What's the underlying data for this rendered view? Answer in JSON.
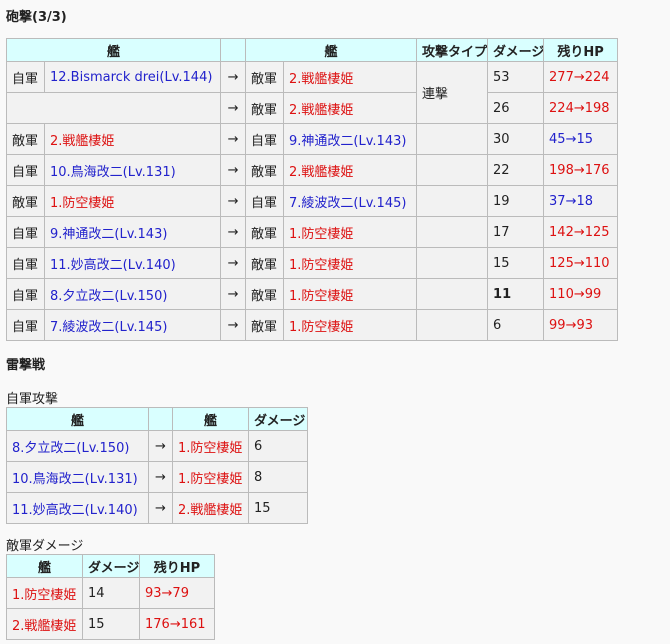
{
  "shelling": {
    "title": "砲撃(3/3)",
    "headers": [
      "艦",
      "艦",
      "攻撃タイプ",
      "ダメージ",
      "残りHP"
    ],
    "attack_type": "連撃",
    "rows": [
      {
        "side_a": "自軍",
        "ship_a": "12.Bismarck drei(Lv.144)",
        "ship_a_color": "blue",
        "arrow": "→",
        "side_b": "敵軍",
        "ship_b": "2.戦艦棲姫",
        "ship_b_color": "red",
        "damage": "53",
        "hp": "277→224",
        "hp_color": "red"
      },
      {
        "side_a": "",
        "ship_a": "",
        "ship_a_color": "blue",
        "arrow": "→",
        "side_b": "敵軍",
        "ship_b": "2.戦艦棲姫",
        "ship_b_color": "red",
        "damage": "26",
        "hp": "224→198",
        "hp_color": "red"
      },
      {
        "side_a": "敵軍",
        "ship_a": "2.戦艦棲姫",
        "ship_a_color": "red",
        "arrow": "→",
        "side_b": "自軍",
        "ship_b": "9.神通改二(Lv.143)",
        "ship_b_color": "blue",
        "damage": "30",
        "hp": "45→15",
        "hp_color": "blue"
      },
      {
        "side_a": "自軍",
        "ship_a": "10.鳥海改二(Lv.131)",
        "ship_a_color": "blue",
        "arrow": "→",
        "side_b": "敵軍",
        "ship_b": "2.戦艦棲姫",
        "ship_b_color": "red",
        "damage": "22",
        "hp": "198→176",
        "hp_color": "red"
      },
      {
        "side_a": "敵軍",
        "ship_a": "1.防空棲姫",
        "ship_a_color": "red",
        "arrow": "→",
        "side_b": "自軍",
        "ship_b": "7.綾波改二(Lv.145)",
        "ship_b_color": "blue",
        "damage": "19",
        "hp": "37→18",
        "hp_color": "blue"
      },
      {
        "side_a": "自軍",
        "ship_a": "9.神通改二(Lv.143)",
        "ship_a_color": "blue",
        "arrow": "→",
        "side_b": "敵軍",
        "ship_b": "1.防空棲姫",
        "ship_b_color": "red",
        "damage": "17",
        "hp": "142→125",
        "hp_color": "red"
      },
      {
        "side_a": "自軍",
        "ship_a": "11.妙高改二(Lv.140)",
        "ship_a_color": "blue",
        "arrow": "→",
        "side_b": "敵軍",
        "ship_b": "1.防空棲姫",
        "ship_b_color": "red",
        "damage": "15",
        "hp": "125→110",
        "hp_color": "red"
      },
      {
        "side_a": "自軍",
        "ship_a": "8.夕立改二(Lv.150)",
        "ship_a_color": "blue",
        "arrow": "→",
        "side_b": "敵軍",
        "ship_b": "1.防空棲姫",
        "ship_b_color": "red",
        "damage": "11",
        "damage_bold": true,
        "hp": "110→99",
        "hp_color": "red"
      },
      {
        "side_a": "自軍",
        "ship_a": "7.綾波改二(Lv.145)",
        "ship_a_color": "blue",
        "arrow": "→",
        "side_b": "敵軍",
        "ship_b": "1.防空棲姫",
        "ship_b_color": "red",
        "damage": "6",
        "hp": "99→93",
        "hp_color": "red"
      }
    ]
  },
  "torpedo": {
    "title": "雷撃戦",
    "attack_label": "自軍攻撃",
    "headers": [
      "艦",
      "艦",
      "ダメージ"
    ],
    "rows": [
      {
        "ship_a": "8.夕立改二(Lv.150)",
        "arrow": "→",
        "ship_b": "1.防空棲姫",
        "damage": "6"
      },
      {
        "ship_a": "10.鳥海改二(Lv.131)",
        "arrow": "→",
        "ship_b": "1.防空棲姫",
        "damage": "8"
      },
      {
        "ship_a": "11.妙高改二(Lv.140)",
        "arrow": "→",
        "ship_b": "2.戦艦棲姫",
        "damage": "15"
      }
    ]
  },
  "enemy_damage": {
    "label": "敵軍ダメージ",
    "headers": [
      "艦",
      "ダメージ",
      "残りHP"
    ],
    "rows": [
      {
        "ship": "1.防空棲姫",
        "damage": "14",
        "hp": "93→79"
      },
      {
        "ship": "2.戦艦棲姫",
        "damage": "15",
        "hp": "176→161"
      }
    ]
  },
  "colors": {
    "blue": "#2222cc",
    "red": "#dd1111",
    "header_bg": "#d9ffff"
  }
}
